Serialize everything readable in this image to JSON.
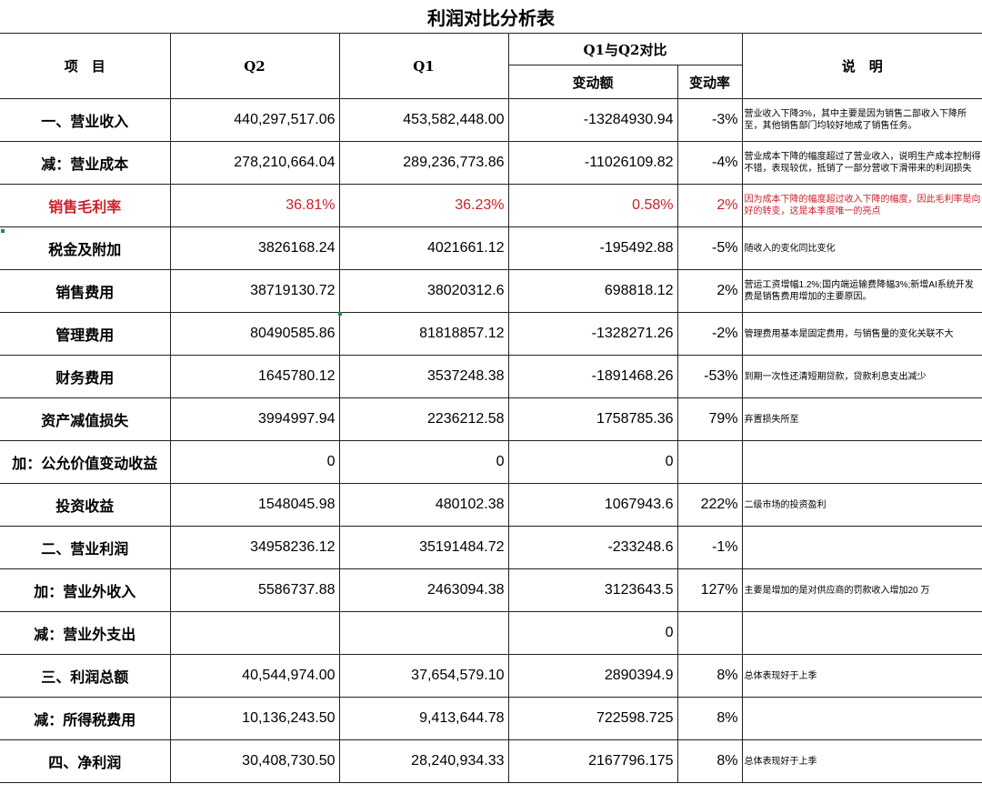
{
  "title": "利润对比分析表",
  "header": {
    "item": "项　目",
    "q2": "Q2",
    "q1": "Q1",
    "compare": "Q1与Q2对比",
    "change_amount": "变动额",
    "change_rate": "变动率",
    "note": "说　明"
  },
  "rows": [
    {
      "item": "一、营业收入",
      "q2": "440,297,517.06",
      "q1": "453,582,448.00",
      "amount": "-13284930.94",
      "rate": "-3%",
      "note": "营业收入下降3%，其中主要是因为销售二部收入下降所至，其他销售部门均较好地成了销售任务。"
    },
    {
      "item": "减：营业成本",
      "q2": "278,210,664.04",
      "q1": "289,236,773.86",
      "amount": "-11026109.82",
      "rate": "-4%",
      "note": "营业成本下降的幅度超过了营业收入，说明生产成本控制得不错，表现较优，抵销了一部分营收下滑带来的利润损失"
    },
    {
      "item": "销售毛利率",
      "q2": "36.81%",
      "q1": "36.23%",
      "amount": "0.58%",
      "rate": "2%",
      "note": "因为成本下降的幅度超过收入下降的幅度，因此毛利率是向好的转变，这是本季度唯一的亮点"
    },
    {
      "item": "税金及附加",
      "q2": "3826168.24",
      "q1": "4021661.12",
      "amount": "-195492.88",
      "rate": "-5%",
      "note": "随收入的变化同比变化"
    },
    {
      "item": "销售费用",
      "q2": "38719130.72",
      "q1": "38020312.6",
      "amount": "698818.12",
      "rate": "2%",
      "note": "营运工资增幅1.2%;国内端运输费降幅3%;新增AI系统开发费是销售费用增加的主要原因。"
    },
    {
      "item": "管理费用",
      "q2": "80490585.86",
      "q1": "81818857.12",
      "amount": "-1328271.26",
      "rate": "-2%",
      "note": "管理费用基本是固定费用，与销售量的变化关联不大"
    },
    {
      "item": "财务费用",
      "q2": "1645780.12",
      "q1": "3537248.38",
      "amount": "-1891468.26",
      "rate": "-53%",
      "note": "到期一次性还清短期贷款，贷款利息支出减少"
    },
    {
      "item": "资产减值损失",
      "q2": "3994997.94",
      "q1": "2236212.58",
      "amount": "1758785.36",
      "rate": "79%",
      "note": "弃置损失所至"
    },
    {
      "item": "加：公允价值变动收益",
      "q2": "0",
      "q1": "0",
      "amount": "0",
      "rate": "",
      "note": ""
    },
    {
      "item": "投资收益",
      "q2": "1548045.98",
      "q1": "480102.38",
      "amount": "1067943.6",
      "rate": "222%",
      "note": "二级市场的投资盈利"
    },
    {
      "item": "二、营业利润",
      "q2": "34958236.12",
      "q1": "35191484.72",
      "amount": "-233248.6",
      "rate": "-1%",
      "note": ""
    },
    {
      "item": "加：营业外收入",
      "q2": "5586737.88",
      "q1": "2463094.38",
      "amount": "3123643.5",
      "rate": "127%",
      "note": "主要是增加的是对供应商的罚款收入增加20 万"
    },
    {
      "item": "减：营业外支出",
      "q2": "",
      "q1": "",
      "amount": "0",
      "rate": "",
      "note": ""
    },
    {
      "item": "三、利润总额",
      "q2": "40,544,974.00",
      "q1": "37,654,579.10",
      "amount": "2890394.9",
      "rate": "8%",
      "note": "总体表现好于上季"
    },
    {
      "item": "减：所得税费用",
      "q2": "10,136,243.50",
      "q1": "9,413,644.78",
      "amount": "722598.725",
      "rate": "8%",
      "note": ""
    },
    {
      "item": "四、净利润",
      "q2": "30,408,730.50",
      "q1": "28,240,934.33",
      "amount": "2167796.175",
      "rate": "8%",
      "note": "总体表现好于上季"
    }
  ],
  "colors": {
    "highlight_text": "#cc1f2a",
    "cell_marker": "#1e8e3e",
    "grid": "#222222"
  }
}
